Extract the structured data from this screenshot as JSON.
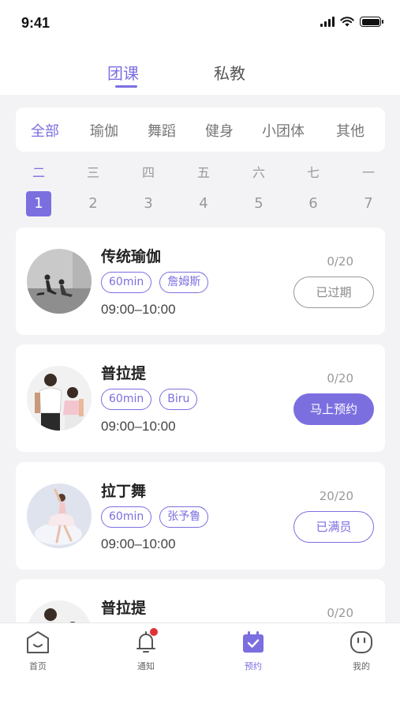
{
  "status_bar": {
    "time": "9:41"
  },
  "top_tabs": [
    {
      "label": "团课",
      "active": true
    },
    {
      "label": "私教",
      "active": false
    }
  ],
  "categories": [
    {
      "label": "全部",
      "active": true
    },
    {
      "label": "瑜伽",
      "active": false
    },
    {
      "label": "舞蹈",
      "active": false
    },
    {
      "label": "健身",
      "active": false
    },
    {
      "label": "小团体",
      "active": false
    },
    {
      "label": "其他",
      "active": false
    }
  ],
  "week": [
    {
      "day": "二",
      "date": "1",
      "active": true
    },
    {
      "day": "三",
      "date": "2",
      "active": false
    },
    {
      "day": "四",
      "date": "3",
      "active": false
    },
    {
      "day": "五",
      "date": "4",
      "active": false
    },
    {
      "day": "六",
      "date": "5",
      "active": false
    },
    {
      "day": "七",
      "date": "6",
      "active": false
    },
    {
      "day": "一",
      "date": "7",
      "active": false
    }
  ],
  "courses": [
    {
      "title": "传统瑜伽",
      "duration": "60min",
      "coach": "詹姆斯",
      "time": "09:00–10:00",
      "count": "0/20",
      "action": "已过期",
      "status": "expired"
    },
    {
      "title": "普拉提",
      "duration": "60min",
      "coach": "Biru",
      "time": "09:00–10:00",
      "count": "0/20",
      "action": "马上预约",
      "status": "book"
    },
    {
      "title": "拉丁舞",
      "duration": "60min",
      "coach": "张予鲁",
      "time": "09:00–10:00",
      "count": "20/20",
      "action": "已满员",
      "status": "full"
    },
    {
      "title": "普拉提",
      "count": "0/20"
    }
  ],
  "bottom_nav": [
    {
      "label": "首页",
      "icon": "home-icon",
      "active": false
    },
    {
      "label": "通知",
      "icon": "bell-icon",
      "active": false,
      "badge": true
    },
    {
      "label": "预约",
      "icon": "calendar-check-icon",
      "active": true
    },
    {
      "label": "我的",
      "icon": "profile-icon",
      "active": false
    }
  ],
  "colors": {
    "accent": "#7b6fe0",
    "background": "#f3f3f6",
    "badge": "#e0303a"
  }
}
